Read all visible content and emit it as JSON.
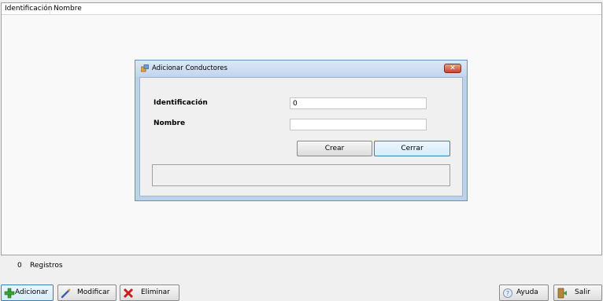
{
  "grid": {
    "columns": [
      "Identificación",
      "Nombre"
    ]
  },
  "dialog": {
    "title": "Adicionar Conductores",
    "close_glyph": "✕",
    "fields": {
      "id_label": "Identificación",
      "id_value": "0",
      "name_label": "Nombre",
      "name_value": ""
    },
    "buttons": {
      "create": "Crear",
      "close": "Cerrar"
    },
    "message": ""
  },
  "footer": {
    "record_count": "0",
    "record_label": "Registros",
    "buttons": {
      "add": "Adicionar",
      "edit": "Modificar",
      "delete": "Eliminar",
      "help": "Ayuda",
      "exit": "Salir"
    }
  },
  "colors": {
    "dialog_frame": "#bcd1ea",
    "focus_border": "#3c7fb1",
    "close_red": "#c8452a"
  }
}
